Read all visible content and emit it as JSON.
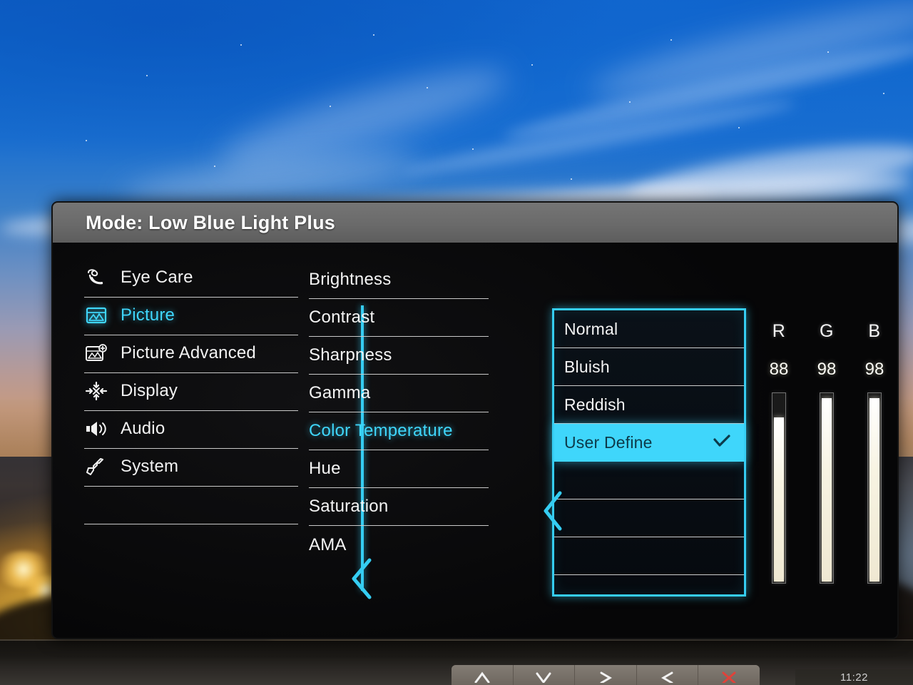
{
  "osd": {
    "title": "Mode: Low Blue Light Plus",
    "accent_color": "#3fd6fb",
    "categories": [
      {
        "label": "Eye Care",
        "icon": "eye-care-icon",
        "active": false
      },
      {
        "label": "Picture",
        "icon": "picture-icon",
        "active": true
      },
      {
        "label": "Picture Advanced",
        "icon": "picture-advanced-icon",
        "active": false
      },
      {
        "label": "Display",
        "icon": "display-icon",
        "active": false
      },
      {
        "label": "Audio",
        "icon": "audio-icon",
        "active": false
      },
      {
        "label": "System",
        "icon": "system-icon",
        "active": false
      }
    ],
    "items": [
      {
        "label": "Brightness",
        "active": false
      },
      {
        "label": "Contrast",
        "active": false
      },
      {
        "label": "Sharpness",
        "active": false
      },
      {
        "label": "Gamma",
        "active": false
      },
      {
        "label": "Color Temperature",
        "active": true
      },
      {
        "label": "Hue",
        "active": false
      },
      {
        "label": "Saturation",
        "active": false
      },
      {
        "label": "AMA",
        "active": false
      }
    ],
    "items_scroll_icon": "chevron-down-icon",
    "options": [
      {
        "label": "Normal",
        "selected": false,
        "check": ""
      },
      {
        "label": "Bluish",
        "selected": false,
        "check": ""
      },
      {
        "label": "Reddish",
        "selected": false,
        "check": ""
      },
      {
        "label": "User Define",
        "selected": true,
        "check": "check-icon"
      },
      {
        "label": "",
        "selected": false,
        "check": ""
      },
      {
        "label": "",
        "selected": false,
        "check": ""
      },
      {
        "label": "",
        "selected": false,
        "check": ""
      }
    ],
    "rgb": [
      {
        "name": "R",
        "value": "88",
        "percent": 88
      },
      {
        "name": "G",
        "value": "98",
        "percent": 98
      },
      {
        "name": "B",
        "value": "98",
        "percent": 98
      }
    ]
  },
  "hardware": {
    "buttons": [
      {
        "icon": "up-arrow-icon",
        "color": "#f2f2f2"
      },
      {
        "icon": "down-arrow-icon",
        "color": "#f2f2f2"
      },
      {
        "icon": "right-arrow-icon",
        "color": "#f2f2f2"
      },
      {
        "icon": "back-arrow-icon",
        "color": "#f2f2f2"
      },
      {
        "icon": "close-x-icon",
        "color": "#e0423a"
      }
    ],
    "clock": "11:22"
  }
}
